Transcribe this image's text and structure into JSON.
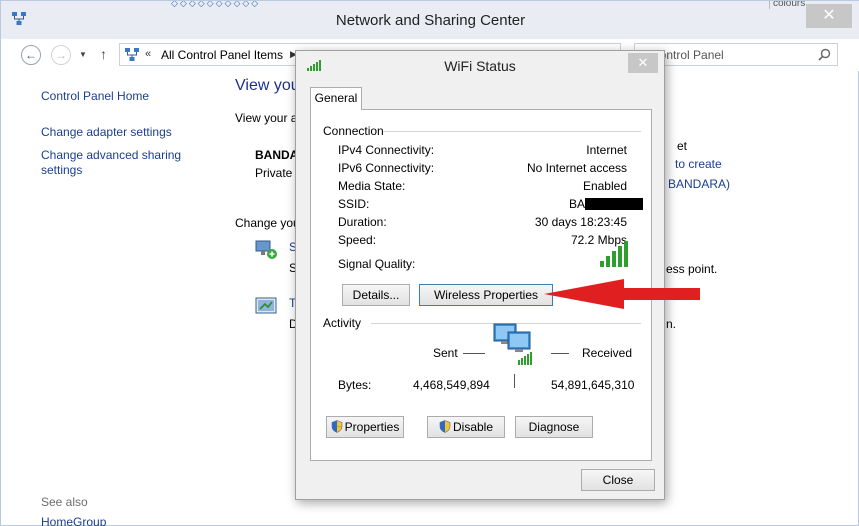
{
  "main_window": {
    "title": "Network and Sharing Center",
    "close_glyph": "✕",
    "top_strip_glyphs": "◇◇◇◇◇◇◇◇◇◇",
    "colours_tab": "colours"
  },
  "address_bar": {
    "back_glyph": "←",
    "forward_glyph": "→",
    "dropdown_glyph": "▼",
    "up_glyph": "↑",
    "breadcrumb_sep": "«",
    "breadcrumb": "All Control Panel Items",
    "breadcrumb_arrow": "▶"
  },
  "search": {
    "placeholder": "h Control Panel"
  },
  "sidebar": {
    "items": [
      {
        "label": "Control Panel Home"
      },
      {
        "label": "Change adapter settings"
      },
      {
        "label": "Change advanced sharing settings"
      }
    ],
    "see_also": "See also",
    "homegroup": "HomeGroup"
  },
  "content": {
    "heading": "View you",
    "active_label": "View your a",
    "network_name": "BANDA",
    "network_type": "Private",
    "change_label": "Change you",
    "task1_letter": "S",
    "task1_sub": "S",
    "task2_letter": "T",
    "task2_sub": "D",
    "right_texts": [
      "et",
      "to create",
      "BANDARA)",
      "ess point.",
      "n."
    ]
  },
  "dialog": {
    "title": "WiFi Status",
    "close_glyph": "✕",
    "tab": "General",
    "connection": {
      "title": "Connection",
      "rows": [
        {
          "label": "IPv4 Connectivity:",
          "value": "Internet"
        },
        {
          "label": "IPv6 Connectivity:",
          "value": "No Internet access"
        },
        {
          "label": "Media State:",
          "value": "Enabled"
        },
        {
          "label": "SSID:",
          "value": "BA"
        },
        {
          "label": "Duration:",
          "value": "30 days 18:23:45"
        },
        {
          "label": "Speed:",
          "value": "72.2 Mbps"
        }
      ],
      "signal_label": "Signal Quality:",
      "signal_bars": 5
    },
    "buttons": {
      "details": "Details...",
      "wireless": "Wireless Properties",
      "properties": "Properties",
      "disable": "Disable",
      "diagnose": "Diagnose",
      "close": "Close"
    },
    "activity": {
      "title": "Activity",
      "sent": "Sent",
      "received": "Received",
      "bytes_label": "Bytes:",
      "bytes_sent": "4,468,549,894",
      "bytes_received": "54,891,645,310"
    }
  },
  "colors": {
    "link": "#1a3f8f",
    "heading": "#1e3287",
    "signal": "#2e9e2e",
    "arrow": "#e02020",
    "close_button": "#c7c7c7"
  }
}
